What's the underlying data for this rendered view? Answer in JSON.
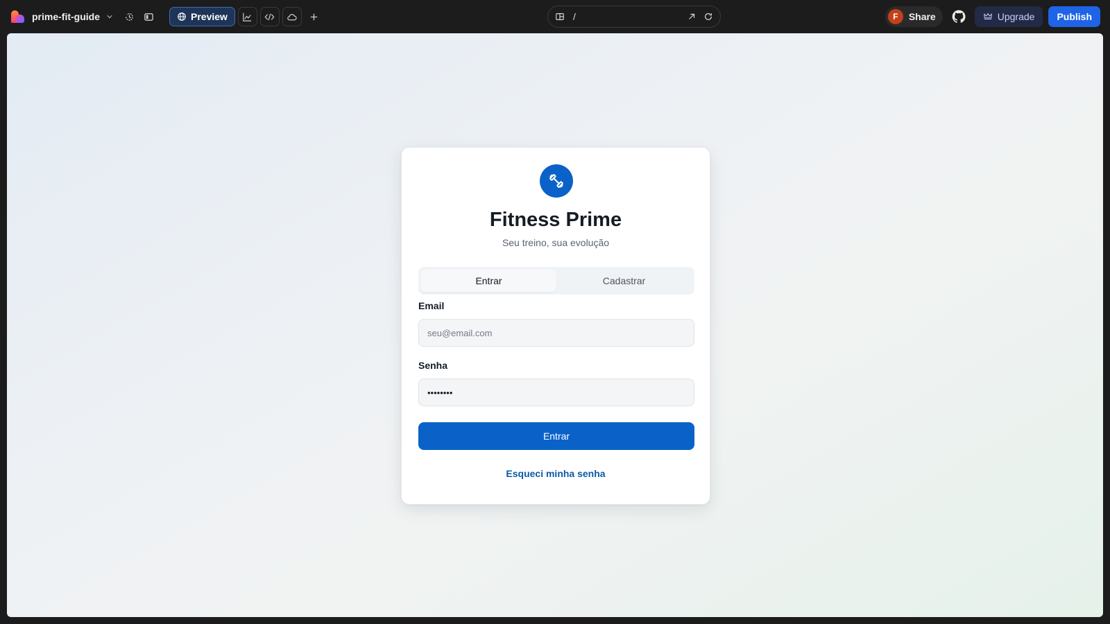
{
  "topbar": {
    "project_name": "prime-fit-guide",
    "preview_label": "Preview",
    "url_path": "/",
    "avatar_initial": "F",
    "share_label": "Share",
    "upgrade_label": "Upgrade",
    "publish_label": "Publish",
    "icons": [
      "history-icon",
      "sidebar-toggle-icon",
      "globe-icon",
      "analytics-icon",
      "code-icon",
      "cloud-icon",
      "plus-icon",
      "page-layout-icon",
      "open-external-icon",
      "refresh-icon",
      "github-icon",
      "crown-icon"
    ]
  },
  "login": {
    "brand_icon": "dumbbell-icon",
    "title": "Fitness Prime",
    "subtitle": "Seu treino, sua evolução",
    "tabs": [
      {
        "label": "Entrar",
        "active": true
      },
      {
        "label": "Cadastrar",
        "active": false
      }
    ],
    "email_label": "Email",
    "email_placeholder": "seu@email.com",
    "password_label": "Senha",
    "password_value": "••••••••",
    "submit_label": "Entrar",
    "forgot_label": "Esqueci minha senha"
  },
  "colors": {
    "primary": "#0a62c9",
    "publish": "#1f63e6",
    "topbar_bg": "#1c1c1c"
  }
}
